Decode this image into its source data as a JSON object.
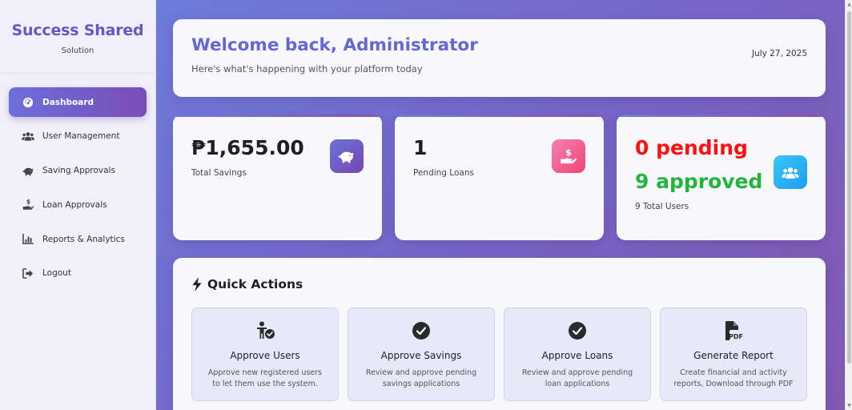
{
  "brand": {
    "title": "Success Shared",
    "subtitle": "Solution"
  },
  "sidebar": {
    "items": [
      {
        "label": "Dashboard",
        "icon": "gauge-icon",
        "active": true
      },
      {
        "label": "User Management",
        "icon": "users-icon"
      },
      {
        "label": "Saving Approvals",
        "icon": "piggy-bank-icon"
      },
      {
        "label": "Loan Approvals",
        "icon": "hand-dollar-icon"
      },
      {
        "label": "Reports & Analytics",
        "icon": "bar-chart-icon"
      },
      {
        "label": "Logout",
        "icon": "logout-icon"
      }
    ]
  },
  "welcome": {
    "title": "Welcome back, Administrator",
    "subtitle": "Here's what's happening with your platform today",
    "date": "July 27, 2025"
  },
  "stats": {
    "savings": {
      "value": "₱1,655.00",
      "label": "Total Savings",
      "icon": "piggy-bank-icon",
      "color": "#6c53c0"
    },
    "loans": {
      "value": "1",
      "label": "Pending Loans",
      "icon": "hand-dollar-icon",
      "color": "#f05a98"
    },
    "users": {
      "pending": "0 pending",
      "approved": "9 approved",
      "label": "9 Total Users",
      "icon": "users-icon",
      "color": "#2ab0f5"
    }
  },
  "quick_actions": {
    "title": "Quick Actions",
    "icon": "bolt-icon",
    "items": [
      {
        "title": "Approve Users",
        "desc": "Approve new registered users to let them use the system.",
        "icon": "user-check-icon"
      },
      {
        "title": "Approve Savings",
        "desc": "Review and approve pending savings applications",
        "icon": "check-circle-icon"
      },
      {
        "title": "Approve Loans",
        "desc": "Review and approve pending loan applications",
        "icon": "check-circle-icon"
      },
      {
        "title": "Generate Report",
        "desc": "Create financial and activity reports, Download through PDF",
        "icon": "pdf-file-icon"
      }
    ]
  },
  "colors": {
    "accent": "#6468d4",
    "pending": "#ff1010",
    "approved": "#22b53b"
  }
}
